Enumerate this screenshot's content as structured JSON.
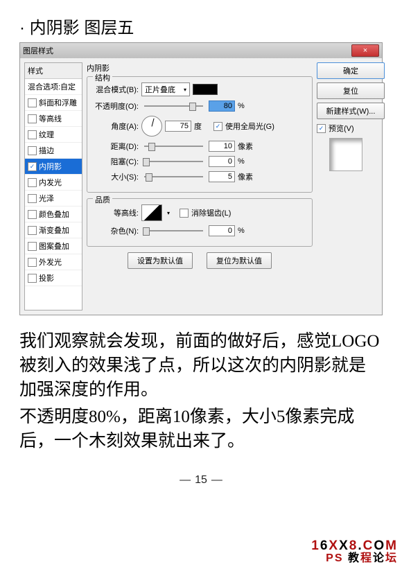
{
  "heading": "· 内阴影 图层五",
  "dialog": {
    "title": "图层样式",
    "close": "×",
    "styles_header": "样式",
    "styles_blend": "混合选项:自定",
    "styles": [
      {
        "label": "斜面和浮雕",
        "checked": false
      },
      {
        "label": "等高线",
        "checked": false
      },
      {
        "label": "纹理",
        "checked": false
      },
      {
        "label": "描边",
        "checked": false
      },
      {
        "label": "内阴影",
        "checked": true,
        "selected": true
      },
      {
        "label": "内发光",
        "checked": false
      },
      {
        "label": "光泽",
        "checked": false
      },
      {
        "label": "颜色叠加",
        "checked": false
      },
      {
        "label": "渐变叠加",
        "checked": false
      },
      {
        "label": "图案叠加",
        "checked": false
      },
      {
        "label": "外发光",
        "checked": false
      },
      {
        "label": "投影",
        "checked": false
      }
    ],
    "panel_title": "内阴影",
    "group_structure": "结构",
    "blend_mode_label": "混合模式(B):",
    "blend_mode_value": "正片叠底",
    "opacity_label": "不透明度(O):",
    "opacity_value": "80",
    "opacity_unit": "%",
    "angle_label": "角度(A):",
    "angle_value": "75",
    "angle_unit": "度",
    "global_light": "使用全局光(G)",
    "distance_label": "距离(D):",
    "distance_value": "10",
    "distance_unit": "像素",
    "choke_label": "阻塞(C):",
    "choke_value": "0",
    "choke_unit": "%",
    "size_label": "大小(S):",
    "size_value": "5",
    "size_unit": "像素",
    "group_quality": "品质",
    "contour_label": "等高线:",
    "antialias": "消除锯齿(L)",
    "noise_label": "杂色(N):",
    "noise_value": "0",
    "noise_unit": "%",
    "set_default": "设置为默认值",
    "reset_default": "复位为默认值",
    "ok": "确定",
    "cancel": "复位",
    "new_style": "新建样式(W)...",
    "preview": "预览(V)"
  },
  "body1": "我们观察就会发现，前面的做好后，感觉LOGO被刻入的效果浅了点，所以这次的内阴影就是加强深度的作用。",
  "body2": "不透明度80%，距离10像素，大小5像素完成后，一个木刻效果就出来了。",
  "page_no": "15"
}
